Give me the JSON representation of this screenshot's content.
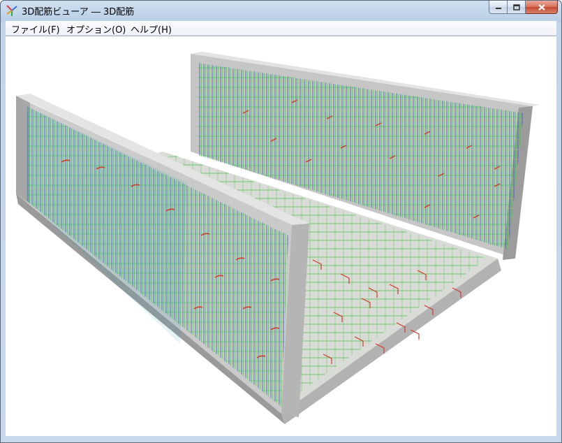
{
  "window": {
    "title": "3D配筋ビューア ― 3D配筋",
    "controls": [
      "minimize",
      "maximize",
      "close"
    ]
  },
  "menu": [
    {
      "label": "ファイル(F)"
    },
    {
      "label": "オプション(O)"
    },
    {
      "label": "ヘルプ(H)"
    }
  ],
  "viewport": {
    "content": "3d-rebar-model",
    "colors": {
      "concrete": "#bdbdbd",
      "rebar_green": "#3fbf3f",
      "rebar_blue": "#3a4fd0",
      "rebar_red": "#d23a2a",
      "rebar_teal": "#1fa0b5"
    }
  }
}
